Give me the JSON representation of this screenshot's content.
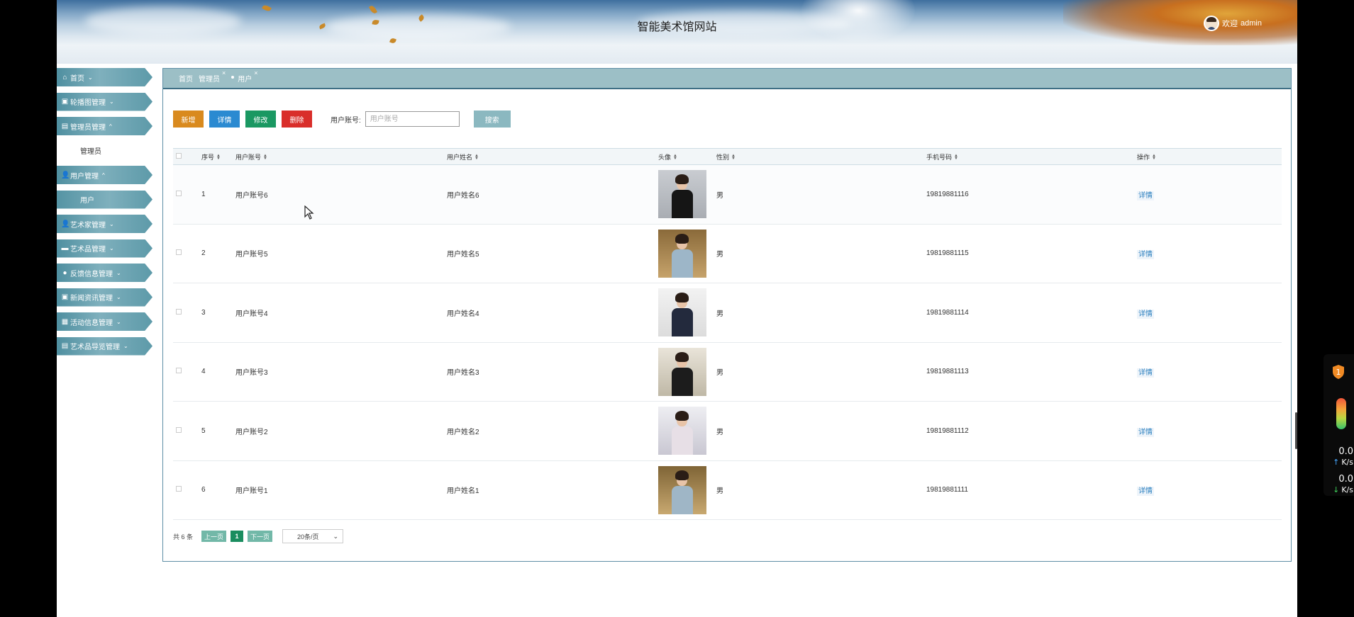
{
  "header": {
    "site_title": "智能美术馆网站",
    "welcome": "欢迎",
    "username": "admin"
  },
  "sidebar": {
    "items": [
      {
        "label": "首页",
        "icon": "home-icon"
      },
      {
        "label": "轮播图管理",
        "icon": "image-icon"
      },
      {
        "label": "管理员管理",
        "icon": "table-icon",
        "expanded": true,
        "children": [
          "管理员"
        ]
      },
      {
        "label": "用户管理",
        "icon": "user-icon",
        "expanded": true,
        "children": [
          "用户"
        ]
      },
      {
        "label": "艺术家管理",
        "icon": "user-icon"
      },
      {
        "label": "艺术品管理",
        "icon": "picture-icon"
      },
      {
        "label": "反馈信息管理",
        "icon": "play-circle-icon"
      },
      {
        "label": "新闻资讯管理",
        "icon": "image-icon"
      },
      {
        "label": "活动信息管理",
        "icon": "grid-icon"
      },
      {
        "label": "艺术品导览管理",
        "icon": "table-icon"
      }
    ]
  },
  "tabs": [
    {
      "label": "首页",
      "closable": false
    },
    {
      "label": "管理员",
      "closable": true
    },
    {
      "label": "用户",
      "closable": true,
      "active": true
    }
  ],
  "toolbar": {
    "add": "新增",
    "detail": "详情",
    "edit": "修改",
    "delete": "删除",
    "search_label": "用户账号:",
    "search_placeholder": "用户账号",
    "search_button": "搜索"
  },
  "table": {
    "columns": [
      "序号",
      "用户账号",
      "用户姓名",
      "头像",
      "性别",
      "手机号码",
      "操作"
    ],
    "rows": [
      {
        "no": "1",
        "account": "用户账号6",
        "name": "用户姓名6",
        "gender": "男",
        "phone": "19819881116",
        "action": "详情"
      },
      {
        "no": "2",
        "account": "用户账号5",
        "name": "用户姓名5",
        "gender": "男",
        "phone": "19819881115",
        "action": "详情"
      },
      {
        "no": "3",
        "account": "用户账号4",
        "name": "用户姓名4",
        "gender": "男",
        "phone": "19819881114",
        "action": "详情"
      },
      {
        "no": "4",
        "account": "用户账号3",
        "name": "用户姓名3",
        "gender": "男",
        "phone": "19819881113",
        "action": "详情"
      },
      {
        "no": "5",
        "account": "用户账号2",
        "name": "用户姓名2",
        "gender": "男",
        "phone": "19819881112",
        "action": "详情"
      },
      {
        "no": "6",
        "account": "用户账号1",
        "name": "用户姓名1",
        "gender": "男",
        "phone": "19819881111",
        "action": "详情"
      }
    ]
  },
  "pager": {
    "total": "共 6 条",
    "prev": "上一页",
    "current": "1",
    "next": "下一页",
    "page_size": "20条/页"
  },
  "widget": {
    "badge": "1",
    "upload_speed": "0.0",
    "download_speed": "0.0",
    "unit": "K/s"
  },
  "colors": {
    "nav_accent": "#5d9aa9",
    "tabbar": "#9cbfc6",
    "add": "#d98a1e",
    "detail": "#2b8ad1",
    "edit": "#1a9862",
    "delete": "#d92e2a",
    "search": "#8bb8c0",
    "pager": "#72b8a8",
    "pager_current": "#1a8d5f"
  }
}
